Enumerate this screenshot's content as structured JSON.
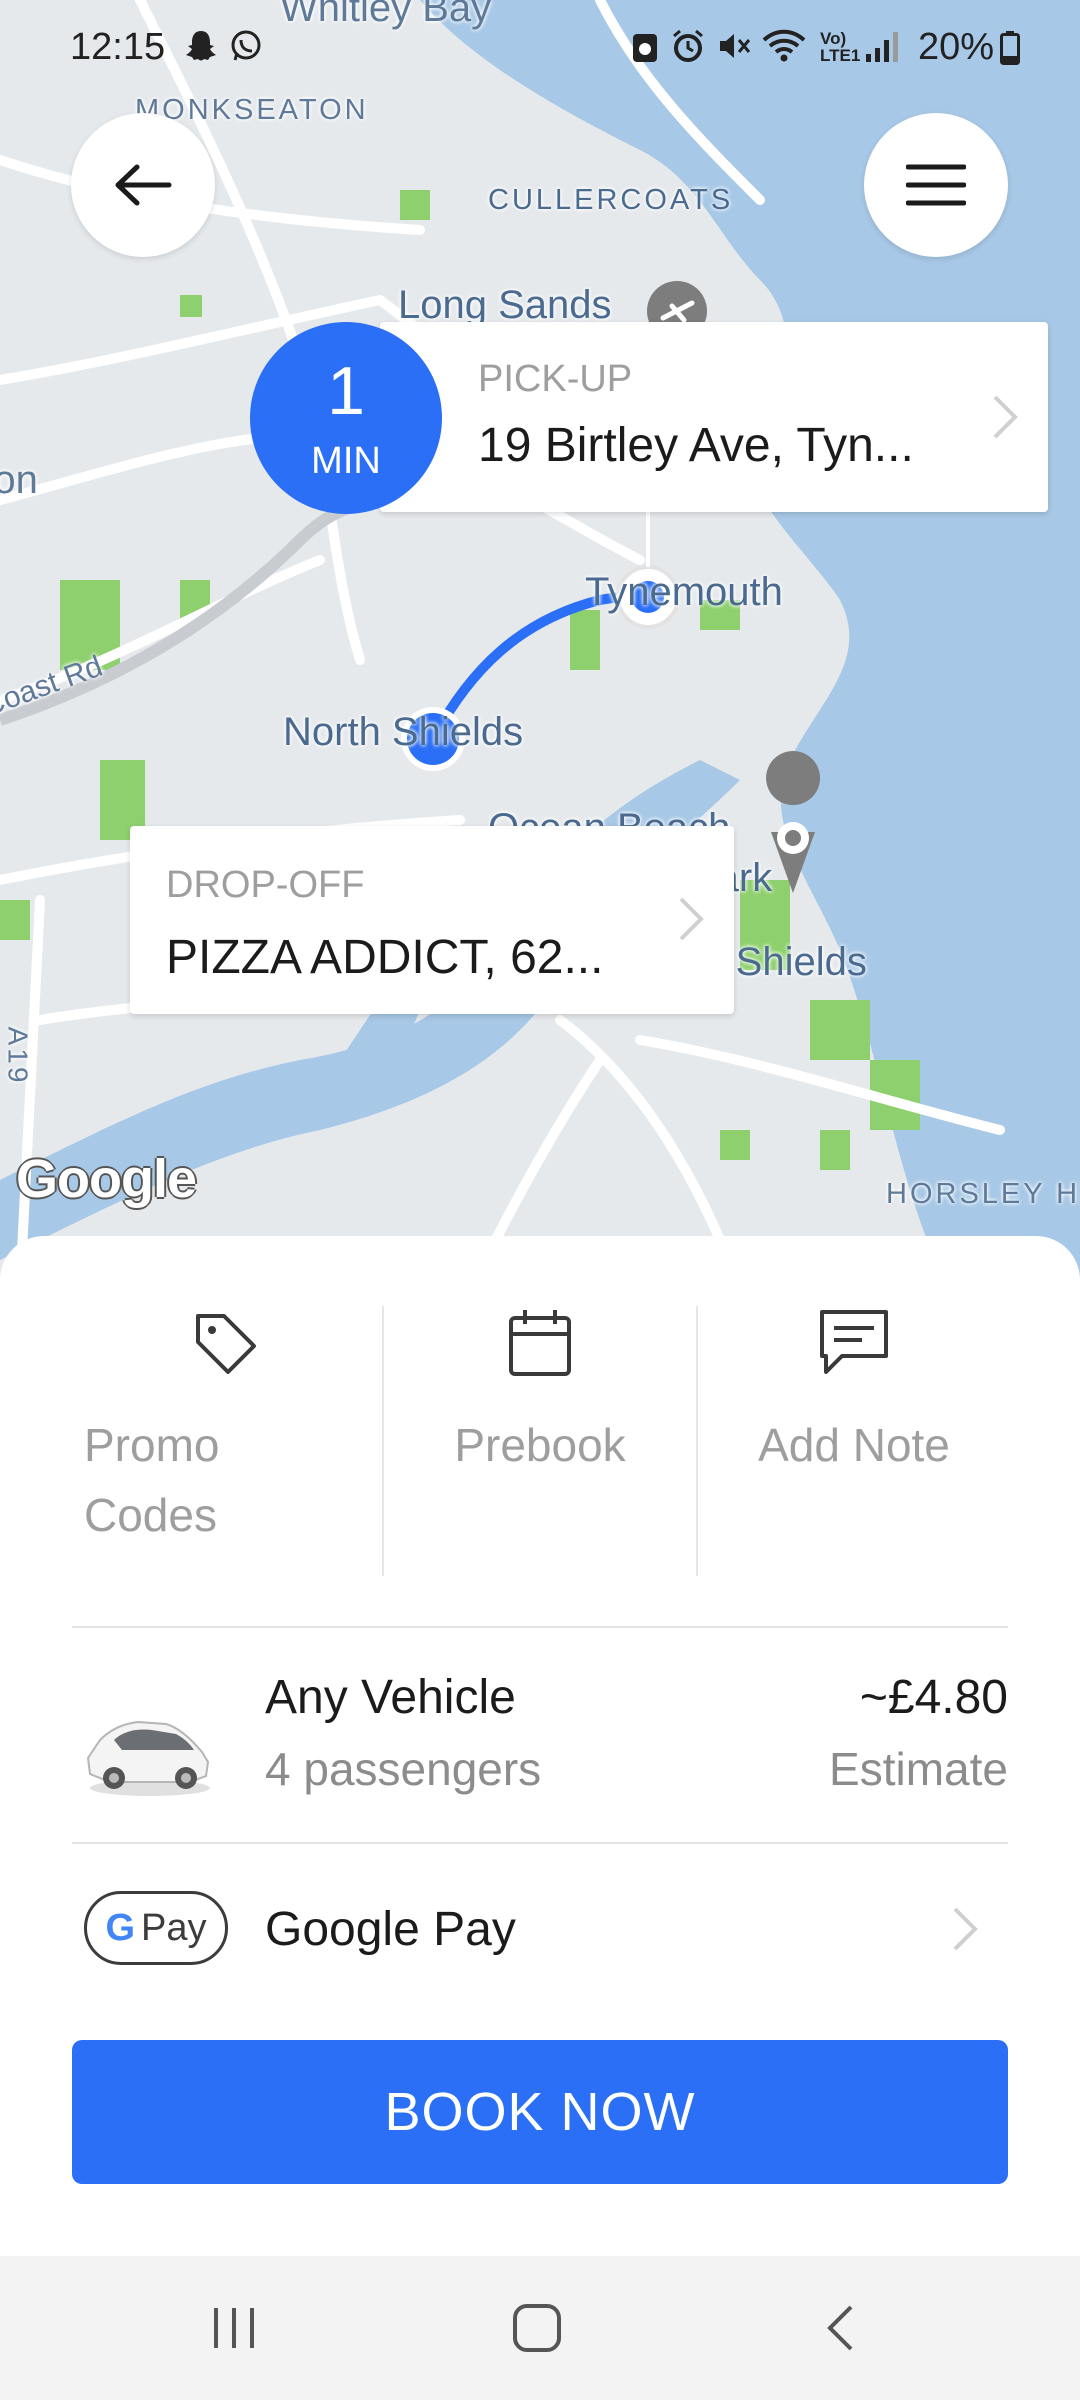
{
  "status_bar": {
    "time": "12:15",
    "battery": "20%",
    "network": "Vo) LTE1",
    "icons": [
      "snapchat-icon",
      "whatsapp-icon",
      "alarm-icon",
      "mute-icon",
      "wifi-icon",
      "signal-icon",
      "battery-icon"
    ]
  },
  "map": {
    "labels": {
      "whitley_bay": "Whitley Bay",
      "monkseaton": "MONKSEATON",
      "cullercoats": "CULLERCOATS",
      "long_sands": "Long Sands",
      "tynemouth": "Tynemouth",
      "north_shields": "North Shields",
      "ocean_beach": "Ocean Beach",
      "park": "Park",
      "south_shields": "South Shields",
      "coast_rd": "Coast Rd",
      "preston": "Preston",
      "a19": "A19",
      "horsley_hill": "HORSLEY HI"
    },
    "google_logo": "Google"
  },
  "header": {
    "back_icon": "arrow-left-icon",
    "menu_icon": "hamburger-menu-icon"
  },
  "pickup": {
    "eta_value": "1",
    "eta_unit": "MIN",
    "caption": "PICK-UP",
    "address": "19 Birtley Ave, Tyn..."
  },
  "dropoff": {
    "caption": "DROP-OFF",
    "address": "PIZZA ADDICT, 62..."
  },
  "options": {
    "promo_line1": "Promo",
    "promo_line2": "Codes",
    "prebook": "Prebook",
    "add_note": "Add Note"
  },
  "vehicle": {
    "name": "Any Vehicle",
    "passengers": "4 passengers",
    "price": "~£4.80",
    "price_note": "Estimate"
  },
  "payment": {
    "badge_g": "G",
    "badge_text": "Pay",
    "label": "Google Pay"
  },
  "book_button": "BOOK NOW",
  "colors": {
    "accent": "#2a6ff5",
    "water": "#a7c8e6",
    "park": "#8fd06e",
    "land": "#e6e9ec"
  }
}
